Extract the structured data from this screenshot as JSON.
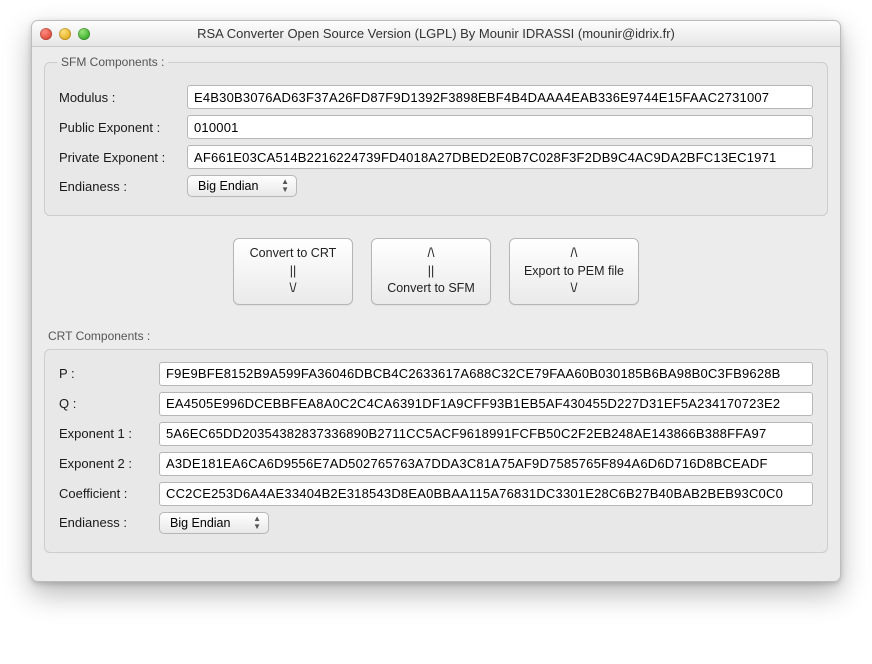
{
  "window": {
    "title": "RSA Converter Open Source Version (LGPL)       By Mounir IDRASSI (mounir@idrix.fr)"
  },
  "sfm": {
    "legend": "SFM Components :",
    "modulus_label": "Modulus :",
    "modulus_value": "E4B30B3076AD63F37A26FD87F9D1392F3898EBF4B4DAAA4EAB336E9744E15FAAC2731007",
    "public_exp_label": "Public Exponent :",
    "public_exp_value": "010001",
    "private_exp_label": "Private Exponent :",
    "private_exp_value": "AF661E03CA514B2216224739FD4018A27DBED2E0B7C028F3F2DB9C4AC9DA2BFC13EC1971",
    "endianess_label": "Endianess :",
    "endianess_value": "Big Endian"
  },
  "buttons": {
    "to_crt": "Convert to CRT\n||\n\\/",
    "to_sfm": "/\\\n||\nConvert to SFM",
    "export_pem": "/\\\nExport to PEM file\n\\/"
  },
  "crt": {
    "legend": "CRT Components :",
    "p_label": "P :",
    "p_value": "F9E9BFE8152B9A599FA36046DBCB4C2633617A688C32CE79FAA60B030185B6BA98B0C3FB9628B",
    "q_label": "Q :",
    "q_value": "EA4505E996DCEBBFEA8A0C2C4CA6391DF1A9CFF93B1EB5AF430455D227D31EF5A234170723E2",
    "exp1_label": "Exponent 1 :",
    "exp1_value": "5A6EC65DD20354382837336890B2711CC5ACF9618991FCFB50C2F2EB248AE143866B388FFA97",
    "exp2_label": "Exponent 2 :",
    "exp2_value": "A3DE181EA6CA6D9556E7AD502765763A7DDA3C81A75AF9D7585765F894A6D6D716D8BCEADF",
    "coeff_label": "Coefficient :",
    "coeff_value": "CC2CE253D6A4AE33404B2E318543D8EA0BBAA115A76831DC3301E28C6B27B40BAB2BEB93C0C0",
    "endianess_label": "Endianess :",
    "endianess_value": "Big Endian"
  }
}
